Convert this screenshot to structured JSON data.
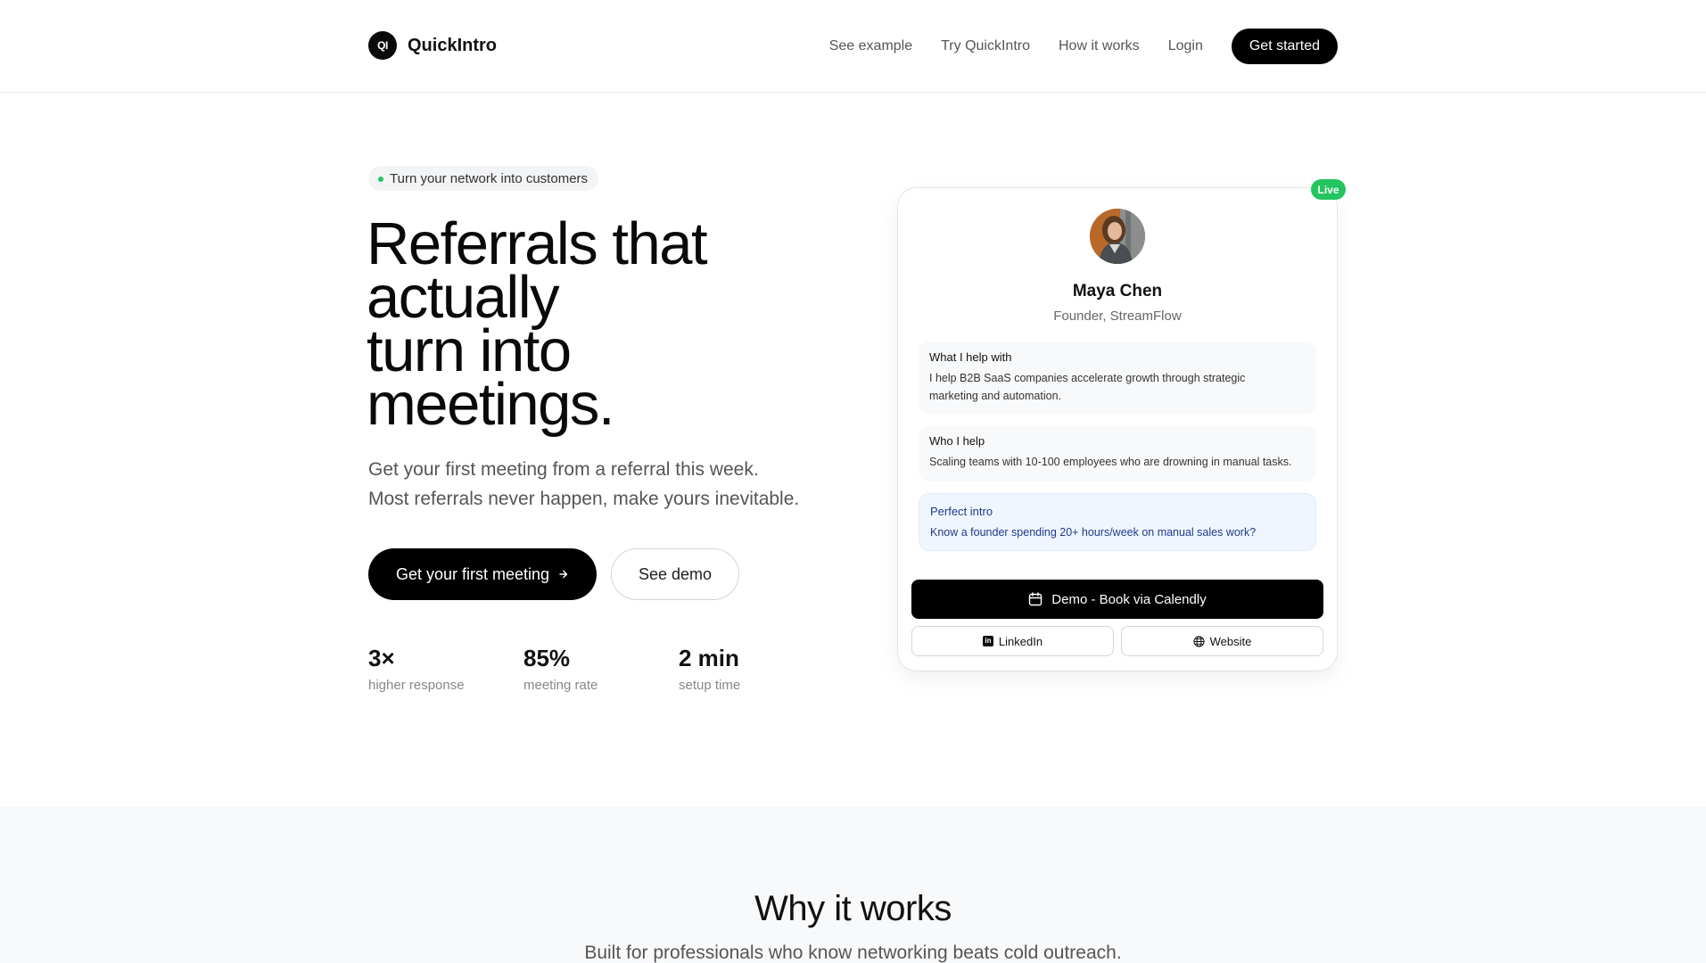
{
  "header": {
    "logo_mark": "QI",
    "logo_text": "QuickIntro",
    "nav": [
      "See example",
      "Try QuickIntro",
      "How it works",
      "Login"
    ],
    "cta": "Get started"
  },
  "hero": {
    "badge": "Turn your network into customers",
    "title_lines": [
      "Referrals that",
      "actually",
      "turn into",
      "meetings."
    ],
    "subtitle_lines": [
      "Get your first meeting from a referral this week.",
      "Most referrals never happen, make yours inevitable."
    ],
    "primary_button": "Get your first meeting",
    "primary_button_icon": "arrow-right-icon",
    "secondary_button": "See demo",
    "stats": [
      {
        "value": "3×",
        "label": "higher response"
      },
      {
        "value": "85%",
        "label": "meeting rate"
      },
      {
        "value": "2 min",
        "label": "setup time"
      }
    ]
  },
  "card": {
    "live_badge": "Live",
    "name": "Maya Chen",
    "role": "Founder, StreamFlow",
    "what_label": "What I help with",
    "what_text_lines": [
      "I help B2B SaaS companies accelerate growth through strategic",
      "marketing and automation."
    ],
    "who_label": "Who I help",
    "who_text": "Scaling teams with 10-100 employees who are drowning in manual tasks.",
    "intro_label": "Perfect intro",
    "intro_text": "Know a founder spending 20+ hours/week on manual sales work?",
    "cta": "Demo - Book via Calendly",
    "cta_icon": "calendar-icon",
    "linkedin": "LinkedIn",
    "website": "Website"
  },
  "section": {
    "title": "Why it works",
    "subtitle": "Built for professionals who know networking beats cold outreach."
  },
  "colors": {
    "accent": "#000000",
    "live": "#22c55e",
    "intro_bg": "#eff6ff",
    "intro_text": "#1e3a8a"
  }
}
